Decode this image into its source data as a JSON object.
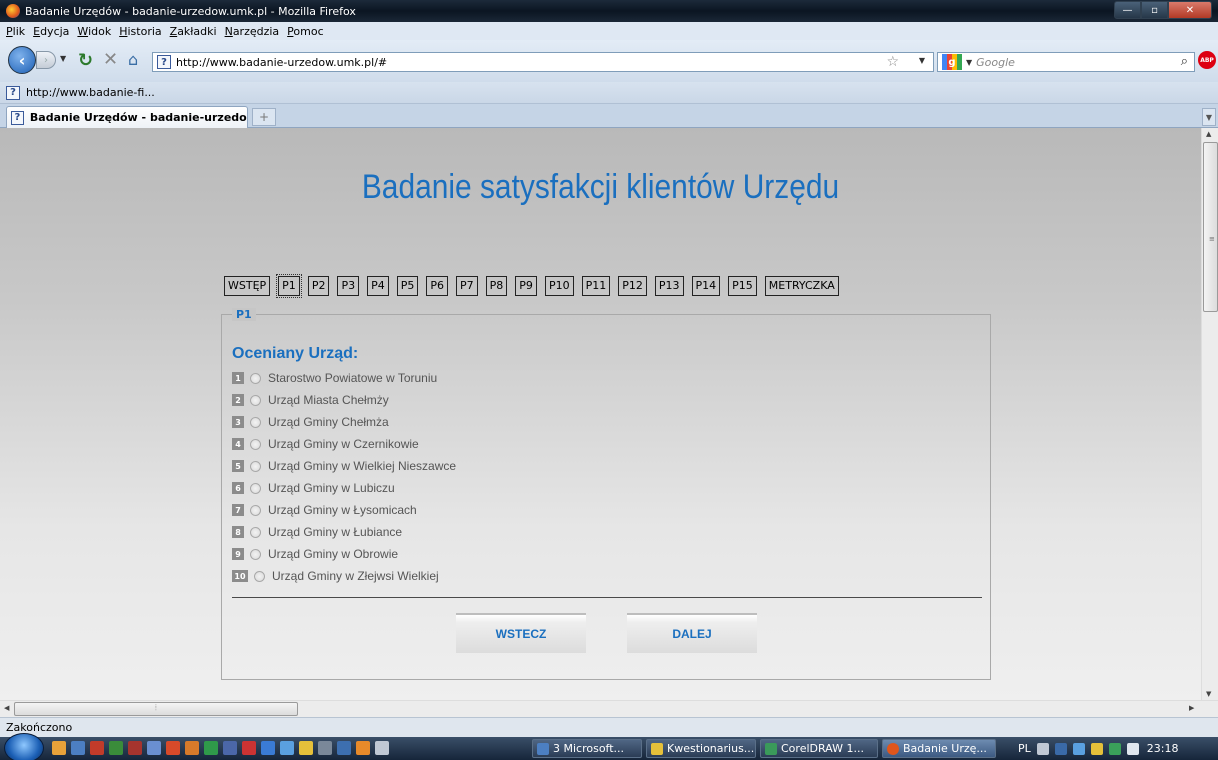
{
  "window": {
    "title": "Badanie Urzędów - badanie-urzedow.umk.pl - Mozilla Firefox"
  },
  "menu": [
    "Plik",
    "Edycja",
    "Widok",
    "Historia",
    "Zakładki",
    "Narzędzia",
    "Pomoc"
  ],
  "navbar": {
    "url": "http://www.badanie-urzedow.umk.pl/#",
    "search_placeholder": "Google",
    "site_icon": "?",
    "adblock_label": "ABP"
  },
  "bookmarks": {
    "item": "http://www.badanie-fi..."
  },
  "tabs": {
    "active_label": "Badanie Urzędów - badanie-urzedow..."
  },
  "page": {
    "title": "Badanie satysfakcji klientów Urzędu",
    "steps": [
      "WSTĘP",
      "P1",
      "P2",
      "P3",
      "P4",
      "P5",
      "P6",
      "P7",
      "P8",
      "P9",
      "P10",
      "P11",
      "P12",
      "P13",
      "P14",
      "P15",
      "METRYCZKA"
    ],
    "active_step": "P1",
    "legend": "P1",
    "question": "Oceniany Urząd:",
    "options": [
      {
        "num": "1",
        "label": "Starostwo Powiatowe w Toruniu"
      },
      {
        "num": "2",
        "label": "Urząd Miasta Chełmży"
      },
      {
        "num": "3",
        "label": "Urząd Gminy Chełmża"
      },
      {
        "num": "4",
        "label": "Urząd Gminy w Czernikowie"
      },
      {
        "num": "5",
        "label": "Urząd Gminy w Wielkiej Nieszawce"
      },
      {
        "num": "6",
        "label": "Urząd Gminy w Lubiczu"
      },
      {
        "num": "7",
        "label": "Urząd Gminy w Łysomicach"
      },
      {
        "num": "8",
        "label": "Urząd Gminy w Łubiance"
      },
      {
        "num": "9",
        "label": "Urząd Gminy w Obrowie"
      },
      {
        "num": "10",
        "label": "Urząd Gminy w Złejwsi Wielkiej"
      }
    ],
    "back_label": "WSTECZ",
    "next_label": "DALEJ"
  },
  "status": {
    "text": "Zakończono"
  },
  "taskbar": {
    "tasks": [
      "3 Microsoft...",
      "Kwestionarius...",
      "CorelDRAW 1...",
      "Badanie Urzę..."
    ],
    "lang": "PL",
    "clock": "23:18"
  },
  "colors": {
    "accent": "#1a6fbf"
  }
}
